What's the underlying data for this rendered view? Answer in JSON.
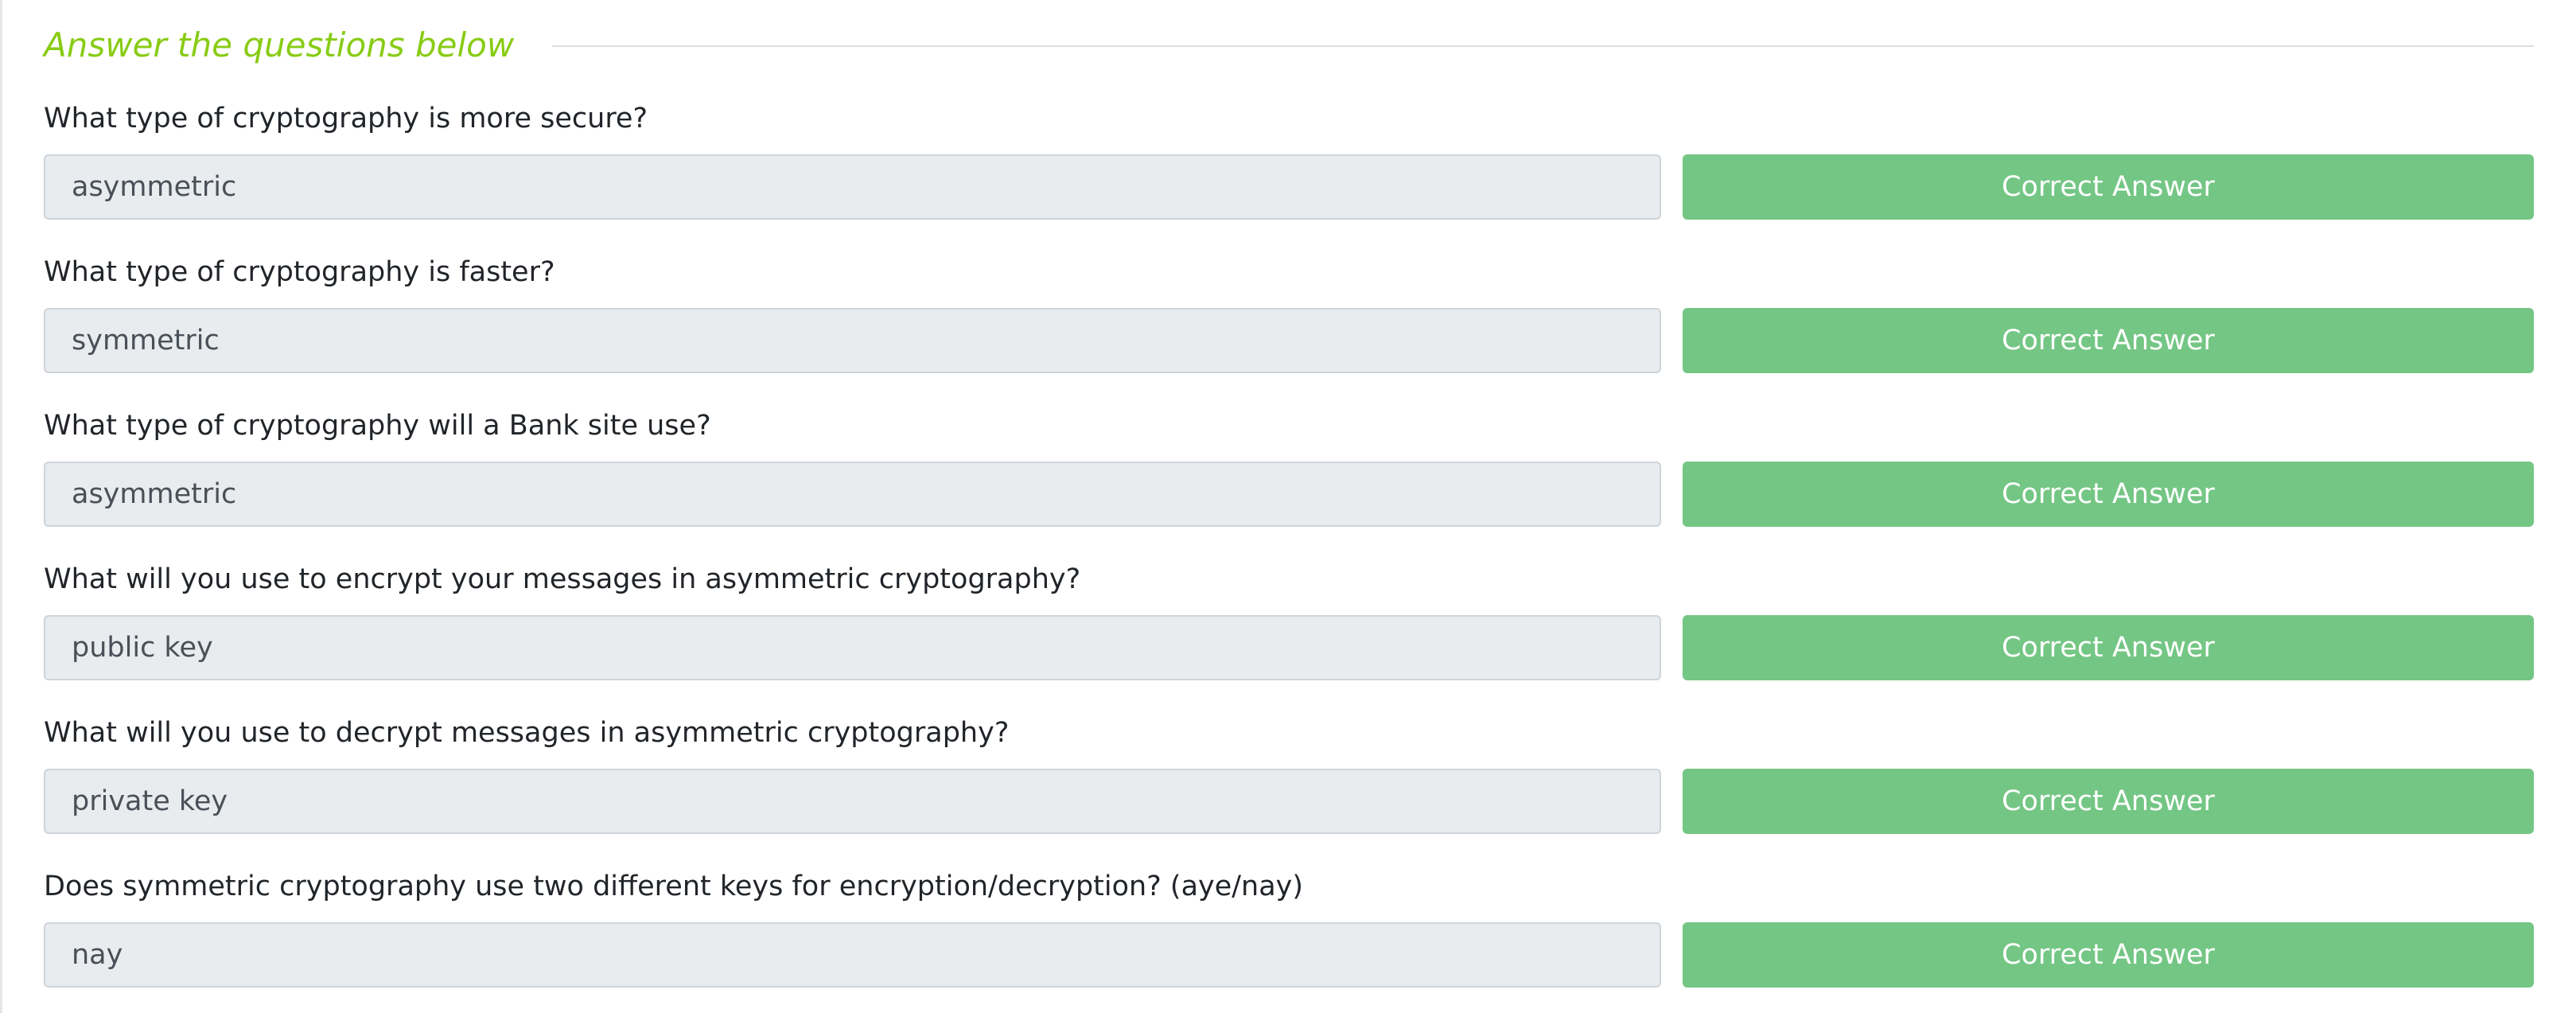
{
  "section": {
    "title": "Answer the questions below"
  },
  "colors": {
    "title_accent": "#88cc14",
    "correct_button": "#74c684",
    "input_background": "#e9ecef"
  },
  "questions": [
    {
      "question": "What type of cryptography is more secure?",
      "answer": "asymmetric",
      "button_label": "Correct Answer"
    },
    {
      "question": "What type of cryptography is faster?",
      "answer": "symmetric",
      "button_label": "Correct Answer"
    },
    {
      "question": "What type of cryptography will a Bank site use?",
      "answer": "asymmetric",
      "button_label": "Correct Answer"
    },
    {
      "question": "What will you use to encrypt your messages in asymmetric cryptography?",
      "answer": "public key",
      "button_label": "Correct Answer"
    },
    {
      "question": "What will you use to decrypt messages in asymmetric cryptography?",
      "answer": "private key",
      "button_label": "Correct Answer"
    },
    {
      "question": "Does symmetric cryptography use two different keys for encryption/decryption? (aye/nay)",
      "answer": "nay",
      "button_label": "Correct Answer"
    }
  ]
}
